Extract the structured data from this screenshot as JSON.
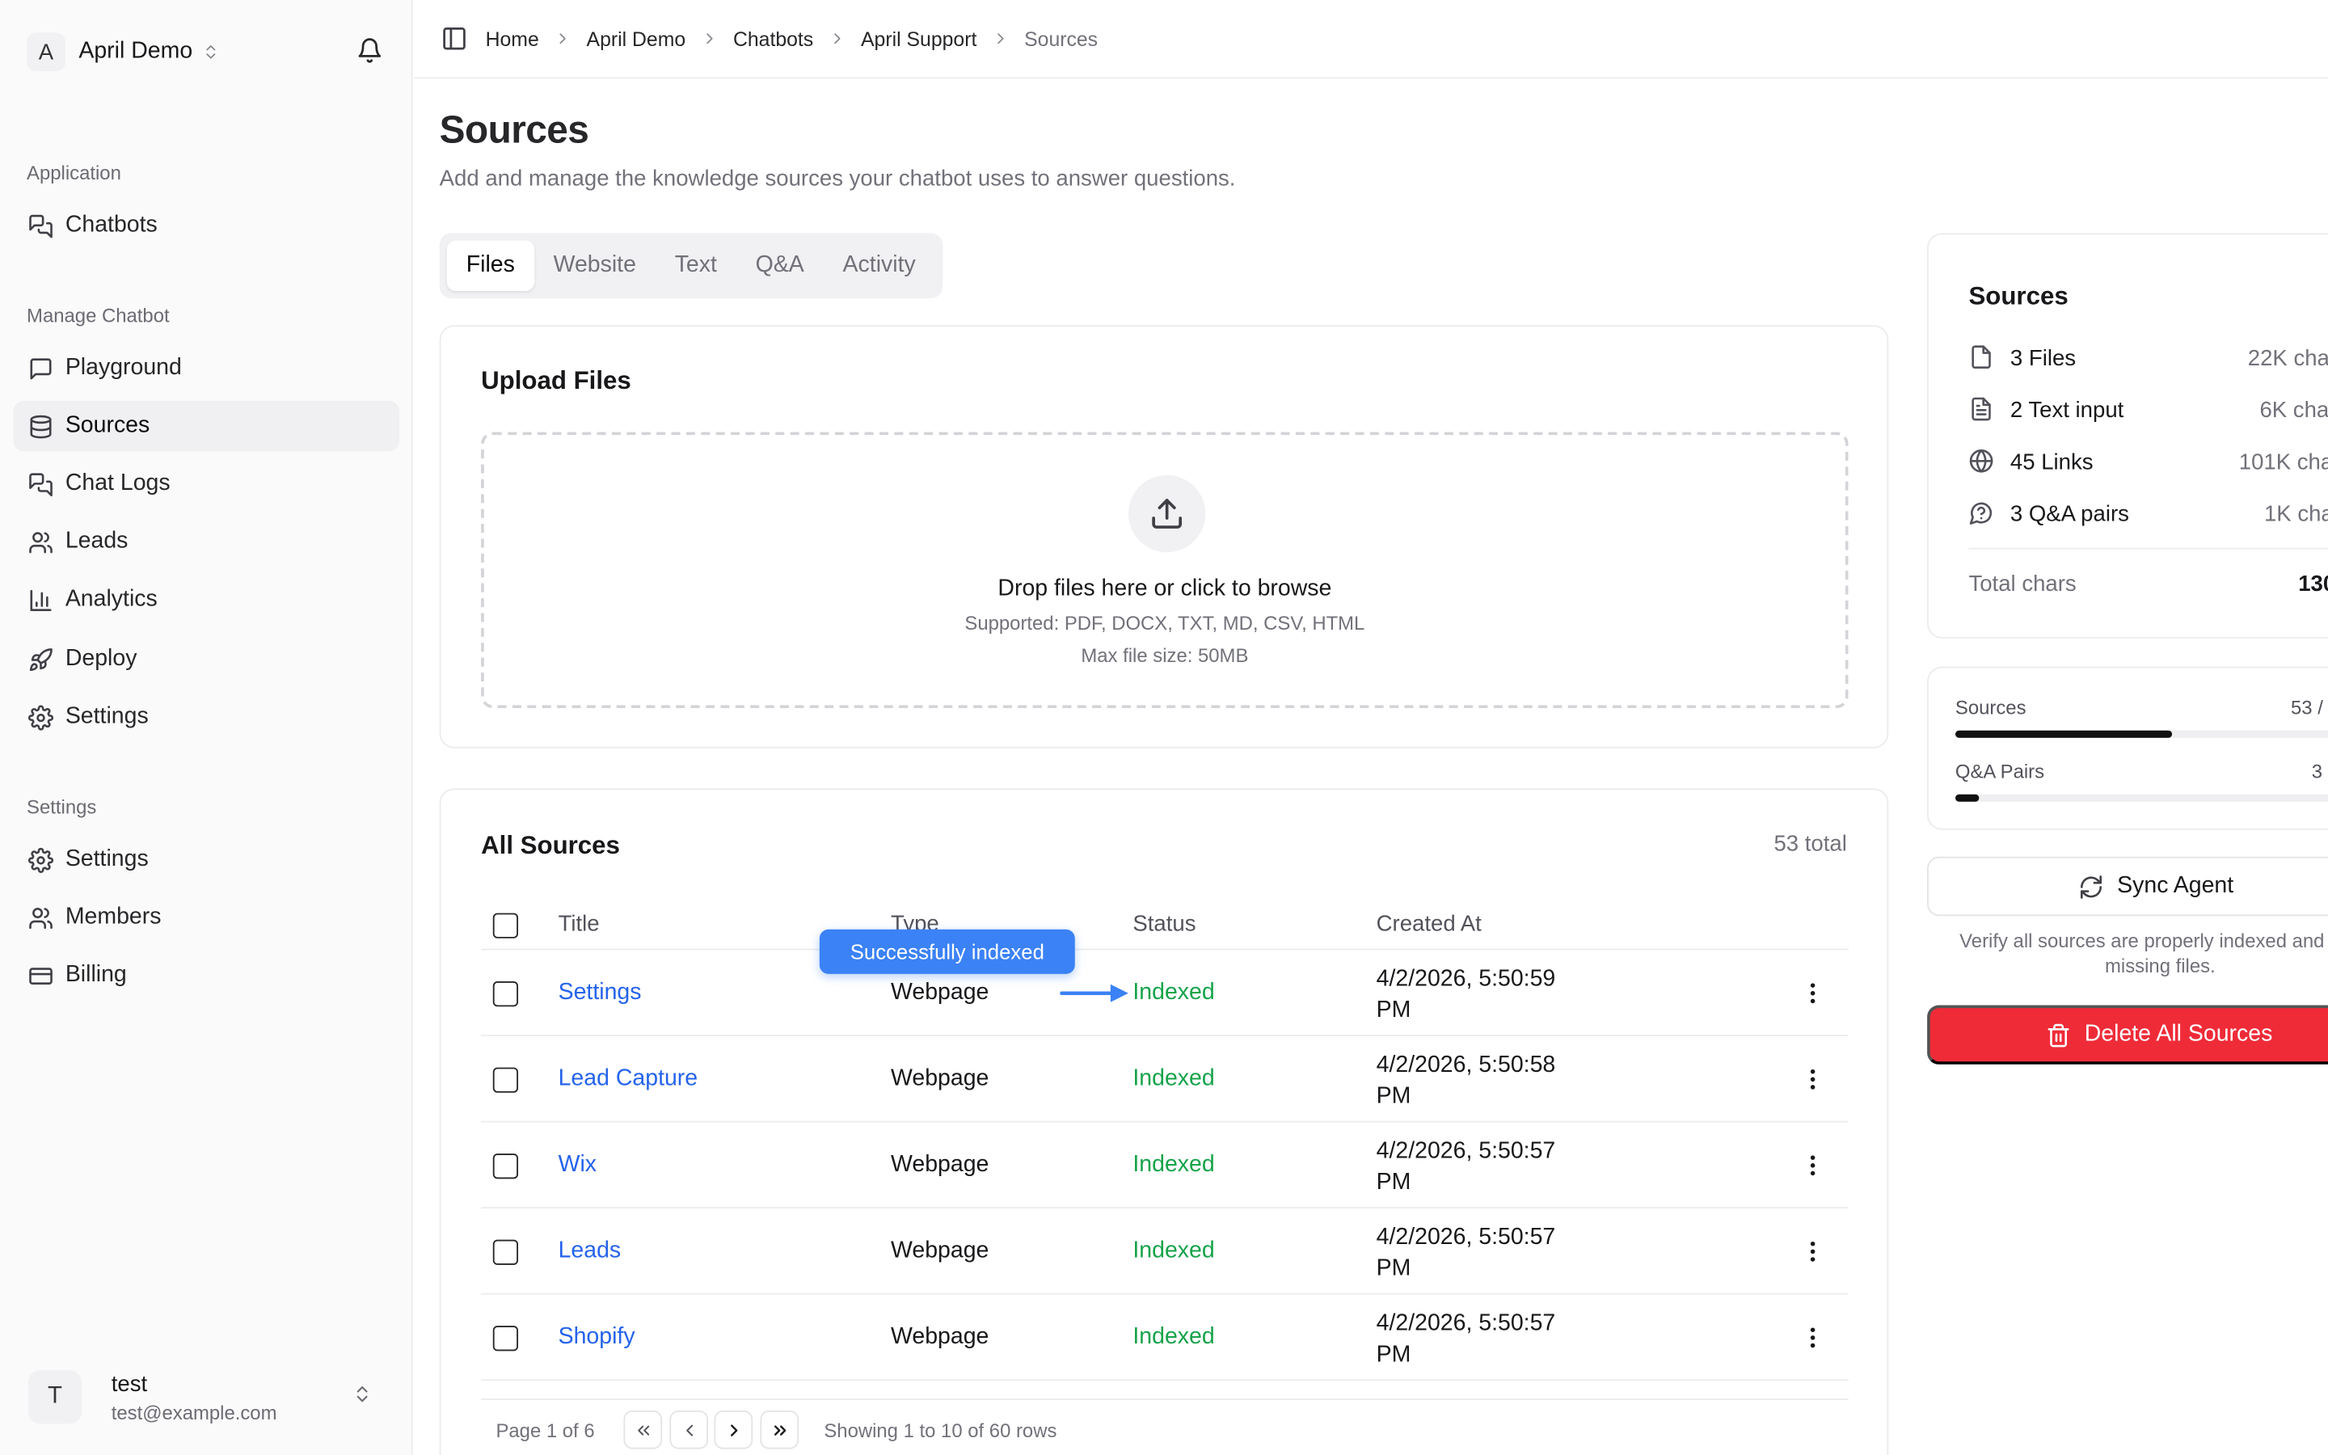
{
  "workspace": {
    "initial": "A",
    "name": "April Demo"
  },
  "sidebar": {
    "groups": [
      {
        "label": "Application"
      },
      {
        "label": "Manage Chatbot"
      },
      {
        "label": "Settings"
      }
    ],
    "items": [
      {
        "label": "Chatbots",
        "icon": "chats-icon"
      },
      {
        "label": "Playground",
        "icon": "message-square-icon"
      },
      {
        "label": "Sources",
        "icon": "database-icon",
        "active": true
      },
      {
        "label": "Chat Logs",
        "icon": "chats-icon"
      },
      {
        "label": "Leads",
        "icon": "users-icon"
      },
      {
        "label": "Analytics",
        "icon": "bar-chart-icon"
      },
      {
        "label": "Deploy",
        "icon": "rocket-icon"
      },
      {
        "label": "Settings",
        "icon": "gear-icon"
      },
      {
        "label": "Settings",
        "icon": "gear-icon"
      },
      {
        "label": "Members",
        "icon": "users-icon"
      },
      {
        "label": "Billing",
        "icon": "credit-card-icon"
      }
    ]
  },
  "user": {
    "initial": "T",
    "name": "test",
    "email": "test@example.com"
  },
  "breadcrumb": [
    "Home",
    "April Demo",
    "Chatbots",
    "April Support",
    "Sources"
  ],
  "page": {
    "title": "Sources",
    "subtitle": "Add and manage the knowledge sources your chatbot uses to answer questions."
  },
  "tabs": [
    {
      "label": "Files",
      "active": true
    },
    {
      "label": "Website"
    },
    {
      "label": "Text"
    },
    {
      "label": "Q&A"
    },
    {
      "label": "Activity"
    }
  ],
  "upload": {
    "title": "Upload Files",
    "drop_title": "Drop files here or click to browse",
    "supported": "Supported: PDF, DOCX, TXT, MD, CSV, HTML",
    "max_size": "Max file size: 50MB"
  },
  "all_sources": {
    "title": "All Sources",
    "total": "53 total",
    "columns": [
      "Title",
      "Type",
      "Status",
      "Created At"
    ],
    "rows": [
      {
        "title": "Settings",
        "type": "Webpage",
        "status": "Indexed",
        "date1": "4/2/2026, 5:50:59",
        "date2": "PM"
      },
      {
        "title": "Lead Capture",
        "type": "Webpage",
        "status": "Indexed",
        "date1": "4/2/2026, 5:50:58",
        "date2": "PM"
      },
      {
        "title": "Wix",
        "type": "Webpage",
        "status": "Indexed",
        "date1": "4/2/2026, 5:50:57",
        "date2": "PM"
      },
      {
        "title": "Leads",
        "type": "Webpage",
        "status": "Indexed",
        "date1": "4/2/2026, 5:50:57",
        "date2": "PM"
      },
      {
        "title": "Shopify",
        "type": "Webpage",
        "status": "Indexed",
        "date1": "4/2/2026, 5:50:57",
        "date2": "PM"
      }
    ],
    "pager": {
      "page": "Page 1 of 6",
      "showing": "Showing 1 to 10 of 60 rows"
    },
    "tooltip": "Successfully indexed"
  },
  "summary": {
    "title": "Sources",
    "items": [
      {
        "label": "3 Files",
        "value": "22K cha",
        "icon": "file-icon"
      },
      {
        "label": "2 Text input",
        "value": "6K cha",
        "icon": "file-text-icon"
      },
      {
        "label": "45 Links",
        "value": "101K cha",
        "icon": "globe-icon"
      },
      {
        "label": "3 Q&A pairs",
        "value": "1K cha",
        "icon": "help-circle-icon"
      }
    ],
    "total_label": "Total chars",
    "total_value": "130"
  },
  "limits": [
    {
      "label": "Sources",
      "value": "53 /",
      "fill": 0.54
    },
    {
      "label": "Q&A Pairs",
      "value": "3",
      "fill": 0.06
    }
  ],
  "actions": {
    "sync": "Sync Agent",
    "sync_note": "Verify all sources are properly indexed and any missing files.",
    "delete": "Delete All Sources"
  },
  "colors": {
    "link": "#2563eb",
    "indexed": "#16a34a",
    "danger": "#ef2b38",
    "tooltip": "#3b82f6"
  }
}
